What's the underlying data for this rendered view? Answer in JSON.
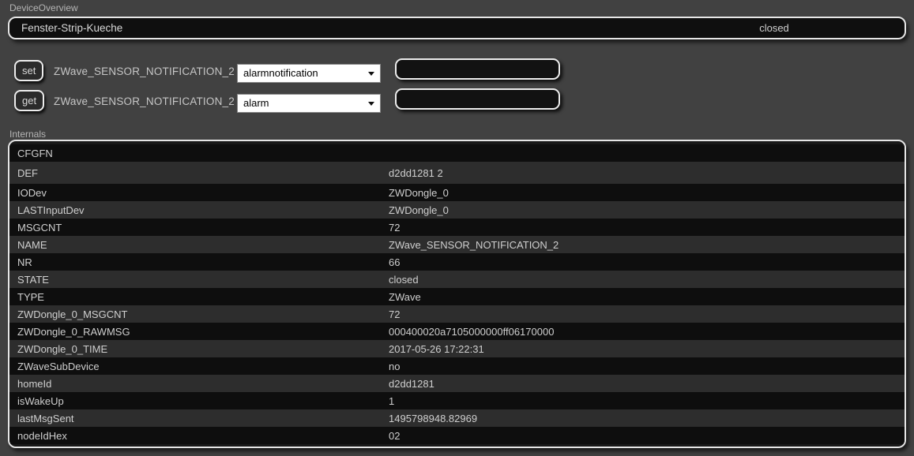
{
  "colors": {
    "page_background": "#414141",
    "panel_background": "#191919",
    "panel_border": "#e6e6e6",
    "row_odd": "#0e0e0e",
    "row_even": "#2d2d2d",
    "text": "#cfcfcf",
    "select_background": "#ffffff"
  },
  "device_overview": {
    "label": "DeviceOverview",
    "device_name": "Fenster-Strip-Kueche",
    "state": "closed"
  },
  "controls": [
    {
      "button": "set",
      "device": "ZWave_SENSOR_NOTIFICATION_2",
      "selected_option": "alarmnotification",
      "input_value": ""
    },
    {
      "button": "get",
      "device": "ZWave_SENSOR_NOTIFICATION_2",
      "selected_option": "alarm",
      "input_value": ""
    }
  ],
  "internals": {
    "label": "Internals",
    "rows": [
      {
        "key": "CFGFN",
        "value": ""
      },
      {
        "key": "DEF",
        "value": "d2dd1281 2",
        "tall": true
      },
      {
        "key": "IODev",
        "value": "ZWDongle_0"
      },
      {
        "key": "LASTInputDev",
        "value": "ZWDongle_0"
      },
      {
        "key": "MSGCNT",
        "value": "72"
      },
      {
        "key": "NAME",
        "value": "ZWave_SENSOR_NOTIFICATION_2"
      },
      {
        "key": "NR",
        "value": "66"
      },
      {
        "key": "STATE",
        "value": "closed"
      },
      {
        "key": "TYPE",
        "value": "ZWave"
      },
      {
        "key": "ZWDongle_0_MSGCNT",
        "value": "72"
      },
      {
        "key": "ZWDongle_0_RAWMSG",
        "value": "000400020a7105000000ff06170000"
      },
      {
        "key": "ZWDongle_0_TIME",
        "value": "2017-05-26 17:22:31"
      },
      {
        "key": "ZWaveSubDevice",
        "value": "no"
      },
      {
        "key": "homeId",
        "value": "d2dd1281"
      },
      {
        "key": "isWakeUp",
        "value": "1"
      },
      {
        "key": "lastMsgSent",
        "value": "1495798948.82969"
      },
      {
        "key": "nodeIdHex",
        "value": "02"
      }
    ]
  }
}
